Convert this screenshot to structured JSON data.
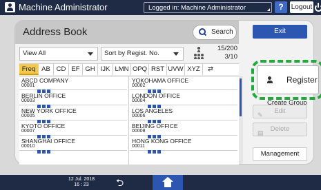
{
  "topbar": {
    "title": "Machine Administrator",
    "login_status": "Logged in: Machine Administrator",
    "help_label": "?",
    "logout_label": "Logout"
  },
  "panel": {
    "title": "Address Book",
    "search_label": "Search",
    "exit_label": "Exit",
    "view_filter": "View All",
    "sort_filter": "Sort by Regist. No.",
    "count_line1": "15/200",
    "count_line2": "3/10"
  },
  "tabs": [
    {
      "label": "Freq",
      "active": true
    },
    {
      "label": "AB"
    },
    {
      "label": "CD"
    },
    {
      "label": "EF"
    },
    {
      "label": "GH"
    },
    {
      "label": "IJK"
    },
    {
      "label": "LMN"
    },
    {
      "label": "OPQ"
    },
    {
      "label": "RST"
    },
    {
      "label": "UVW"
    },
    {
      "label": "XYZ"
    }
  ],
  "entries": [
    {
      "name": "ABCD COMPANY",
      "num": "00001"
    },
    {
      "name": "YOKOHAMA OFFICE",
      "num": "00002"
    },
    {
      "name": "BERLIN OFFICE",
      "num": "00003"
    },
    {
      "name": "LONDON OFFICE",
      "num": "00004"
    },
    {
      "name": "NEW YORK OFFICE",
      "num": "00005"
    },
    {
      "name": "LOS ANGELES",
      "num": "00006"
    },
    {
      "name": "KYOTO OFFICE",
      "num": "00007"
    },
    {
      "name": "BEIJING OFFICE",
      "num": "00008"
    },
    {
      "name": "SHANGHAI OFFICE",
      "num": "00010"
    },
    {
      "name": "HONG KONG OFFICE",
      "num": "00011"
    }
  ],
  "side": {
    "register_label": "Register",
    "create_group_label": "Create Group",
    "edit_label": "Edit",
    "delete_label": "Delete",
    "management_label": "Management"
  },
  "bottombar": {
    "date": "12 Jul. 2018",
    "time": "16 : 23"
  },
  "colors": {
    "topbar": "#1f2b44",
    "accent": "#2d56b0",
    "active_tab": "#f2c94c",
    "highlight": "#1faa3c"
  }
}
